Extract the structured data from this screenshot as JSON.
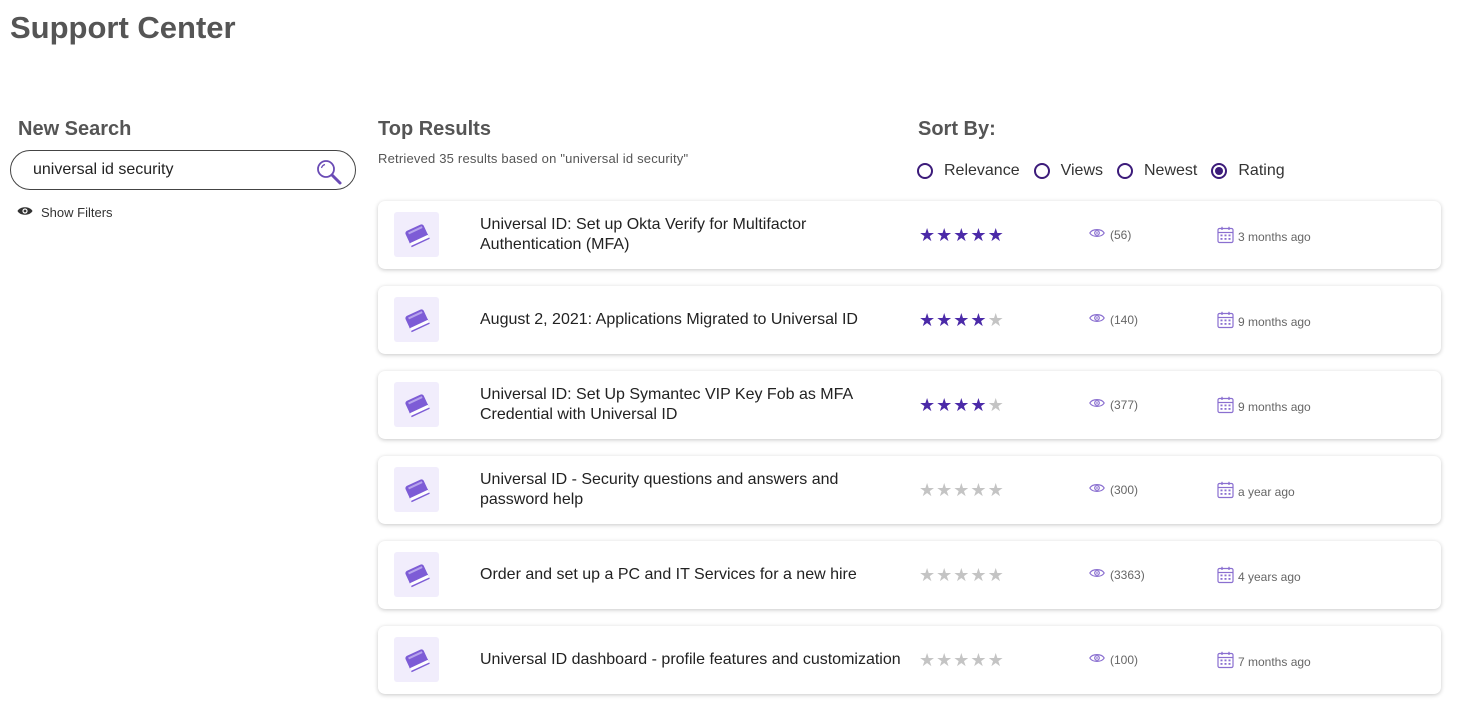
{
  "page": {
    "title": "Support Center"
  },
  "colors": {
    "accent": "#3c1b7a",
    "star_filled": "#4b2aa8",
    "star_empty": "#c4c4c4",
    "icon_purple": "#7d5cd6",
    "tile_bg": "#f1edfc"
  },
  "search": {
    "heading": "New Search",
    "value": "universal id security",
    "button_icon": "magnifier-icon",
    "show_filters_label": "Show Filters",
    "show_filters_icon": "eye-icon"
  },
  "results": {
    "heading": "Top Results",
    "subtitle": "Retrieved 35 results based on \"universal id security\"",
    "items": [
      {
        "title": "Universal ID: Set up Okta Verify for Multifactor Authentication (MFA)",
        "rating": 5,
        "views": "(56)",
        "date": "3 months ago",
        "icon": "book-icon"
      },
      {
        "title": "August 2, 2021: Applications Migrated to Universal ID",
        "rating": 4,
        "views": "(140)",
        "date": "9 months ago",
        "icon": "book-icon"
      },
      {
        "title": "Universal ID: Set Up Symantec VIP Key Fob as MFA Credential with Universal ID",
        "rating": 4,
        "views": "(377)",
        "date": "9 months ago",
        "icon": "book-icon"
      },
      {
        "title": "Universal ID - Security questions and answers and password help",
        "rating": 0,
        "views": "(300)",
        "date": "a year ago",
        "icon": "book-icon"
      },
      {
        "title": "Order and set up a PC and IT Services for a new hire",
        "rating": 0,
        "views": "(3363)",
        "date": "4 years ago",
        "icon": "book-icon"
      },
      {
        "title": "Universal ID dashboard - profile features and customization",
        "rating": 0,
        "views": "(100)",
        "date": "7 months ago",
        "icon": "book-icon"
      }
    ]
  },
  "sort": {
    "heading": "Sort By:",
    "selected": "Rating",
    "options": [
      {
        "label": "Relevance",
        "checked": false
      },
      {
        "label": "Views",
        "checked": false
      },
      {
        "label": "Newest",
        "checked": false
      },
      {
        "label": "Rating",
        "checked": true
      }
    ]
  }
}
